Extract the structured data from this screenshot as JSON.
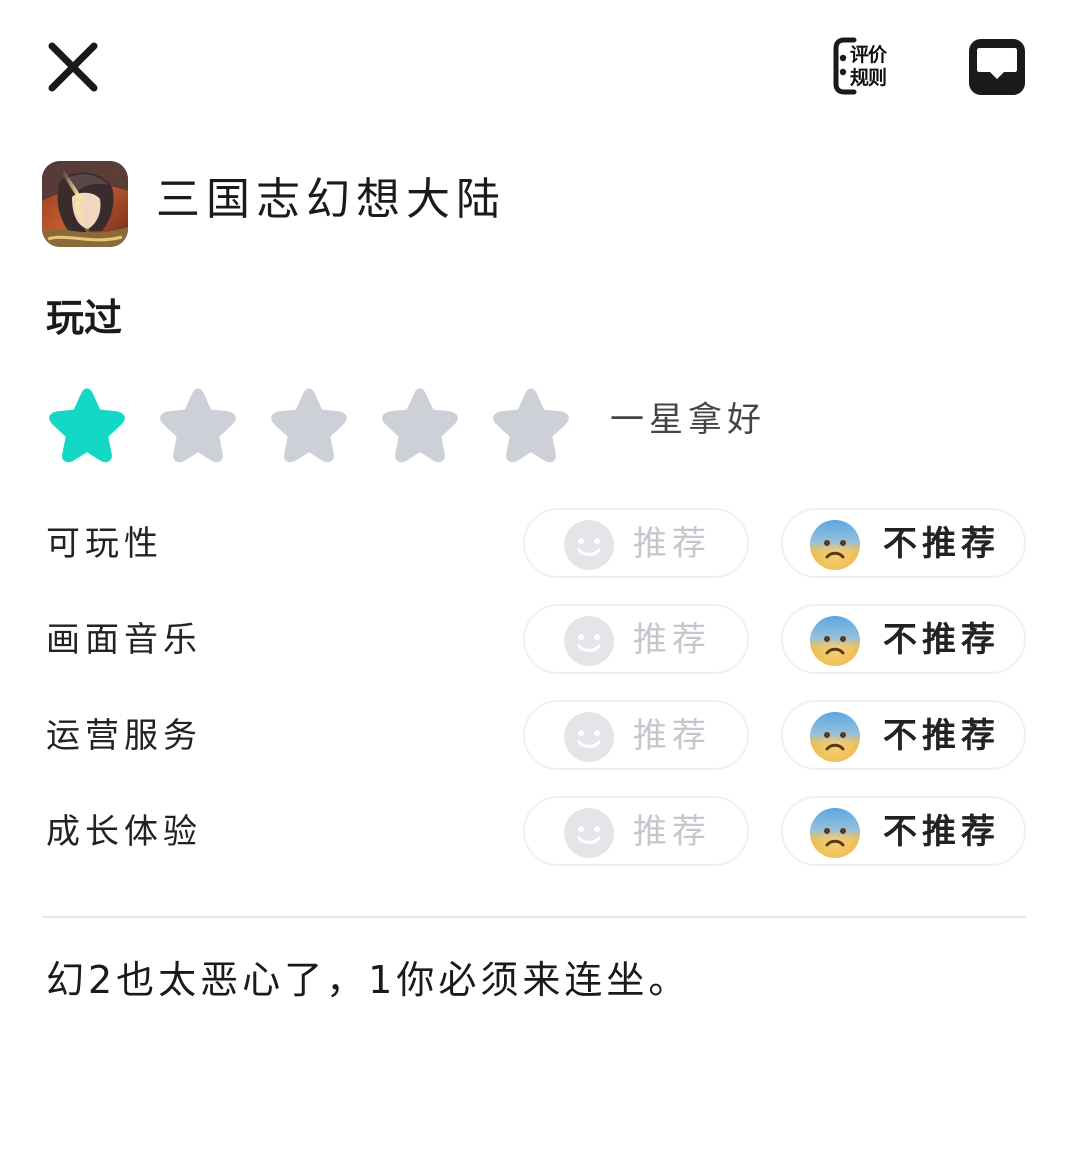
{
  "header": {
    "close_icon": "close-icon",
    "rules_line1": "评价",
    "rules_line2": "规则",
    "chat_icon": "chat-bubble-icon"
  },
  "app": {
    "name": "三国志幻想大陆",
    "icon": "app-icon"
  },
  "status": "玩过",
  "rating": {
    "value": 1,
    "max": 5,
    "label": "一星拿好",
    "active_color": "#14d8c6",
    "inactive_color": "#cdd0d6"
  },
  "aspects": [
    {
      "label": "可玩性",
      "recommend": "推荐",
      "not_recommend": "不推荐",
      "selected": "not_recommend"
    },
    {
      "label": "画面音乐",
      "recommend": "推荐",
      "not_recommend": "不推荐",
      "selected": "not_recommend"
    },
    {
      "label": "运营服务",
      "recommend": "推荐",
      "not_recommend": "不推荐",
      "selected": "not_recommend"
    },
    {
      "label": "成长体验",
      "recommend": "推荐",
      "not_recommend": "不推荐",
      "selected": "not_recommend"
    }
  ],
  "review": {
    "text": "幻2也太恶心了，1你必须来连坐。"
  }
}
